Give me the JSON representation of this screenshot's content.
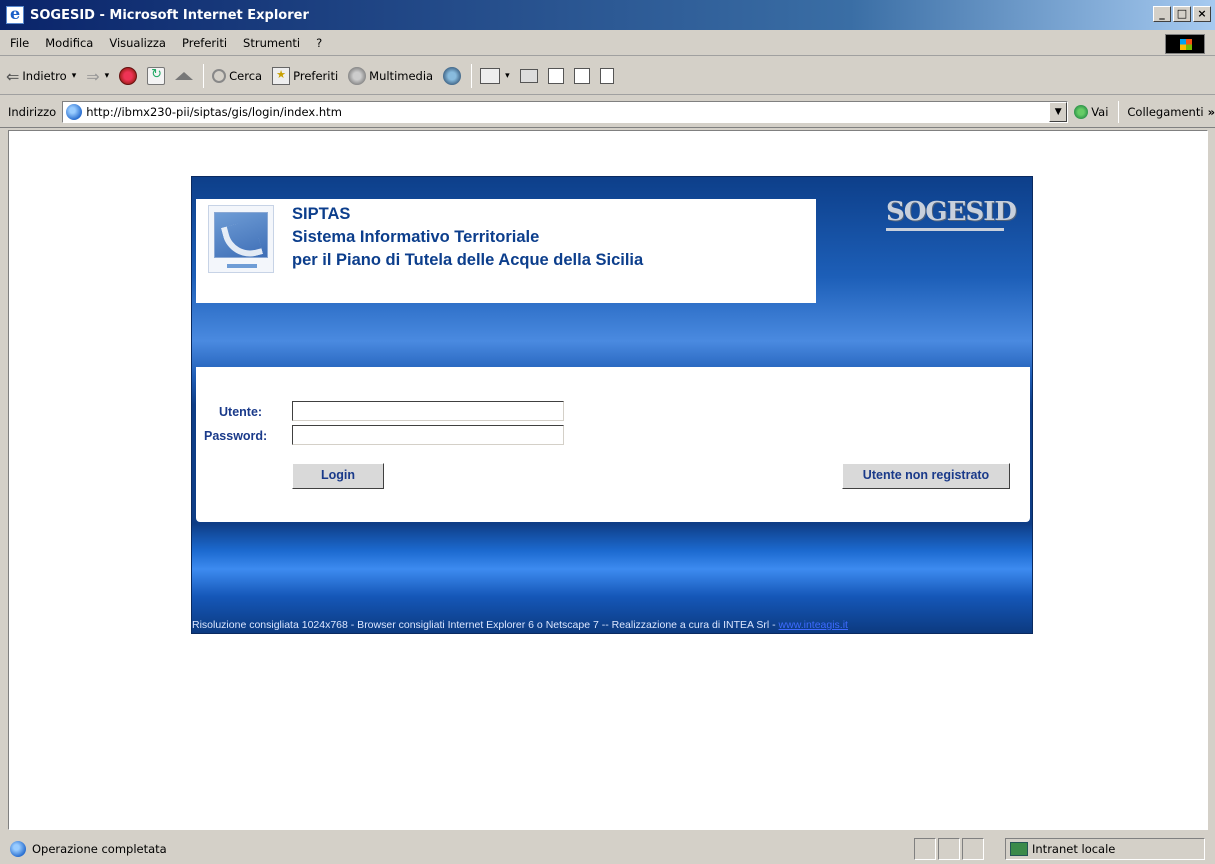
{
  "window": {
    "title": "SOGESID - Microsoft Internet Explorer",
    "controls": [
      "_",
      "□",
      "×"
    ]
  },
  "menu": [
    "File",
    "Modifica",
    "Visualizza",
    "Preferiti",
    "Strumenti",
    "?"
  ],
  "toolbar": {
    "back": "Indietro",
    "search": "Cerca",
    "favorites": "Preferiti",
    "media": "Multimedia"
  },
  "address": {
    "label": "Indirizzo",
    "url": "http://ibmx230-pii/siptas/gis/login/index.htm",
    "go": "Vai",
    "links": "Collegamenti",
    "more": "»"
  },
  "page": {
    "header": {
      "line1": "SIPTAS",
      "line2": "Sistema Informativo Territoriale",
      "line3": "per il Piano di Tutela delle Acque della Sicilia",
      "brand": "SOGESID"
    },
    "form": {
      "user_label": "Utente:",
      "user_value": "",
      "password_label": "Password:",
      "password_value": "",
      "login_button": "Login",
      "guest_button": "Utente non registrato"
    },
    "footer": {
      "text": "Risoluzione consigliata 1024x768 - Browser consigliati Internet Explorer 6 o Netscape 7 -- Realizzazione a cura di INTEA Srl - ",
      "link": "www.inteagis.it"
    }
  },
  "status": {
    "text": "Operazione completata",
    "zone": "Intranet locale"
  }
}
